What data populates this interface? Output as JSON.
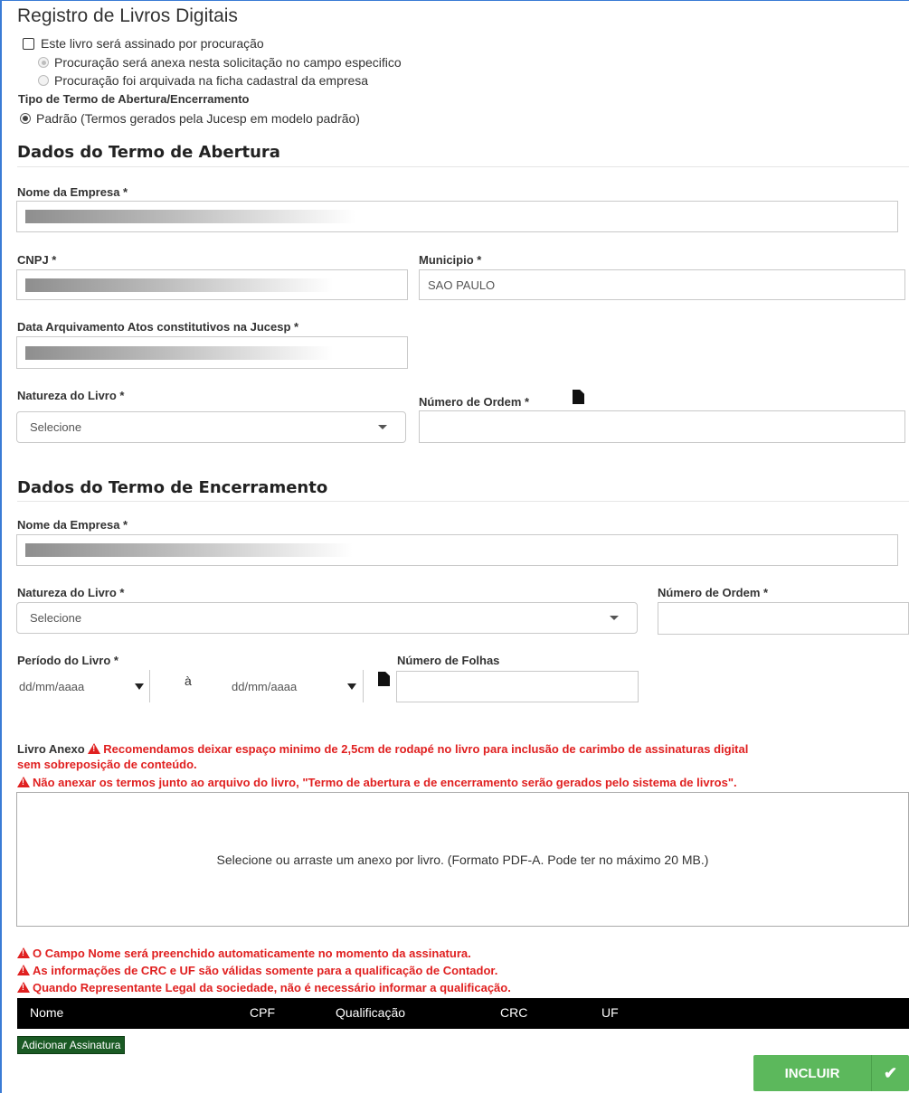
{
  "page": {
    "title": "Registro de Livros Digitais",
    "procuracao": {
      "checkbox_label": "Este livro será assinado por procuração",
      "option1": "Procuração será anexa nesta solicitação no campo especifico",
      "option2": "Procuração foi arquivada na ficha cadastral da empresa"
    },
    "tipo_termo": {
      "label": "Tipo de Termo de Abertura/Encerramento",
      "option": "Padrão (Termos gerados pela Jucesp em modelo padrão)"
    }
  },
  "abertura": {
    "section_title": "Dados do Termo de Abertura",
    "nome_empresa_label": "Nome da Empresa *",
    "cnpj_label": "CNPJ *",
    "municipio_label": "Municipio *",
    "municipio_value": "SAO PAULO",
    "data_arquivamento_label": "Data Arquivamento Atos constitutivos na Jucesp *",
    "natureza_label": "Natureza do Livro *",
    "natureza_value": "Selecione",
    "numero_ordem_label": "Número de Ordem *"
  },
  "encerramento": {
    "section_title": "Dados do Termo de Encerramento",
    "nome_empresa_label": "Nome da Empresa *",
    "natureza_label": "Natureza do Livro *",
    "natureza_value": "Selecione",
    "numero_ordem_label": "Número de Ordem *",
    "periodo_label": "Período do Livro *",
    "periodo_sep": "à",
    "date_placeholder": "dd/mm/aaaa",
    "numero_folhas_label": "Número de Folhas"
  },
  "anexo": {
    "label": "Livro Anexo",
    "warning1": "Recomendamos deixar espaço minimo de 2,5cm de rodapé no livro para inclusão de carimbo de assinaturas digital",
    "warning1_cont": "sem sobreposição de conteúdo.",
    "warning2": "Não anexar os termos junto ao arquivo do livro, \"Termo de abertura e de encerramento serão gerados pelo sistema de livros\".",
    "dropzone_text": "Selecione ou arraste um anexo por livro. (Formato PDF-A. Pode ter no máximo 20 MB.)"
  },
  "assinaturas": {
    "notes": [
      "O Campo Nome será preenchido automaticamente no momento da assinatura.",
      "As informações de CRC e UF são válidas somente para a qualificação de Contador.",
      "Quando Representante Legal da sociedade, não é necessário informar a qualificação."
    ],
    "columns": [
      "Nome",
      "CPF",
      "Qualificação",
      "CRC",
      "UF"
    ],
    "add_button": "Adicionar Assinatura"
  },
  "actions": {
    "incluir": "INCLUIR",
    "incluir_icon": "check-icon"
  },
  "colors": {
    "warning": "#e02020",
    "incluir": "#5cb85c",
    "add_button": "#1a5a24",
    "table_header": "#000000"
  }
}
